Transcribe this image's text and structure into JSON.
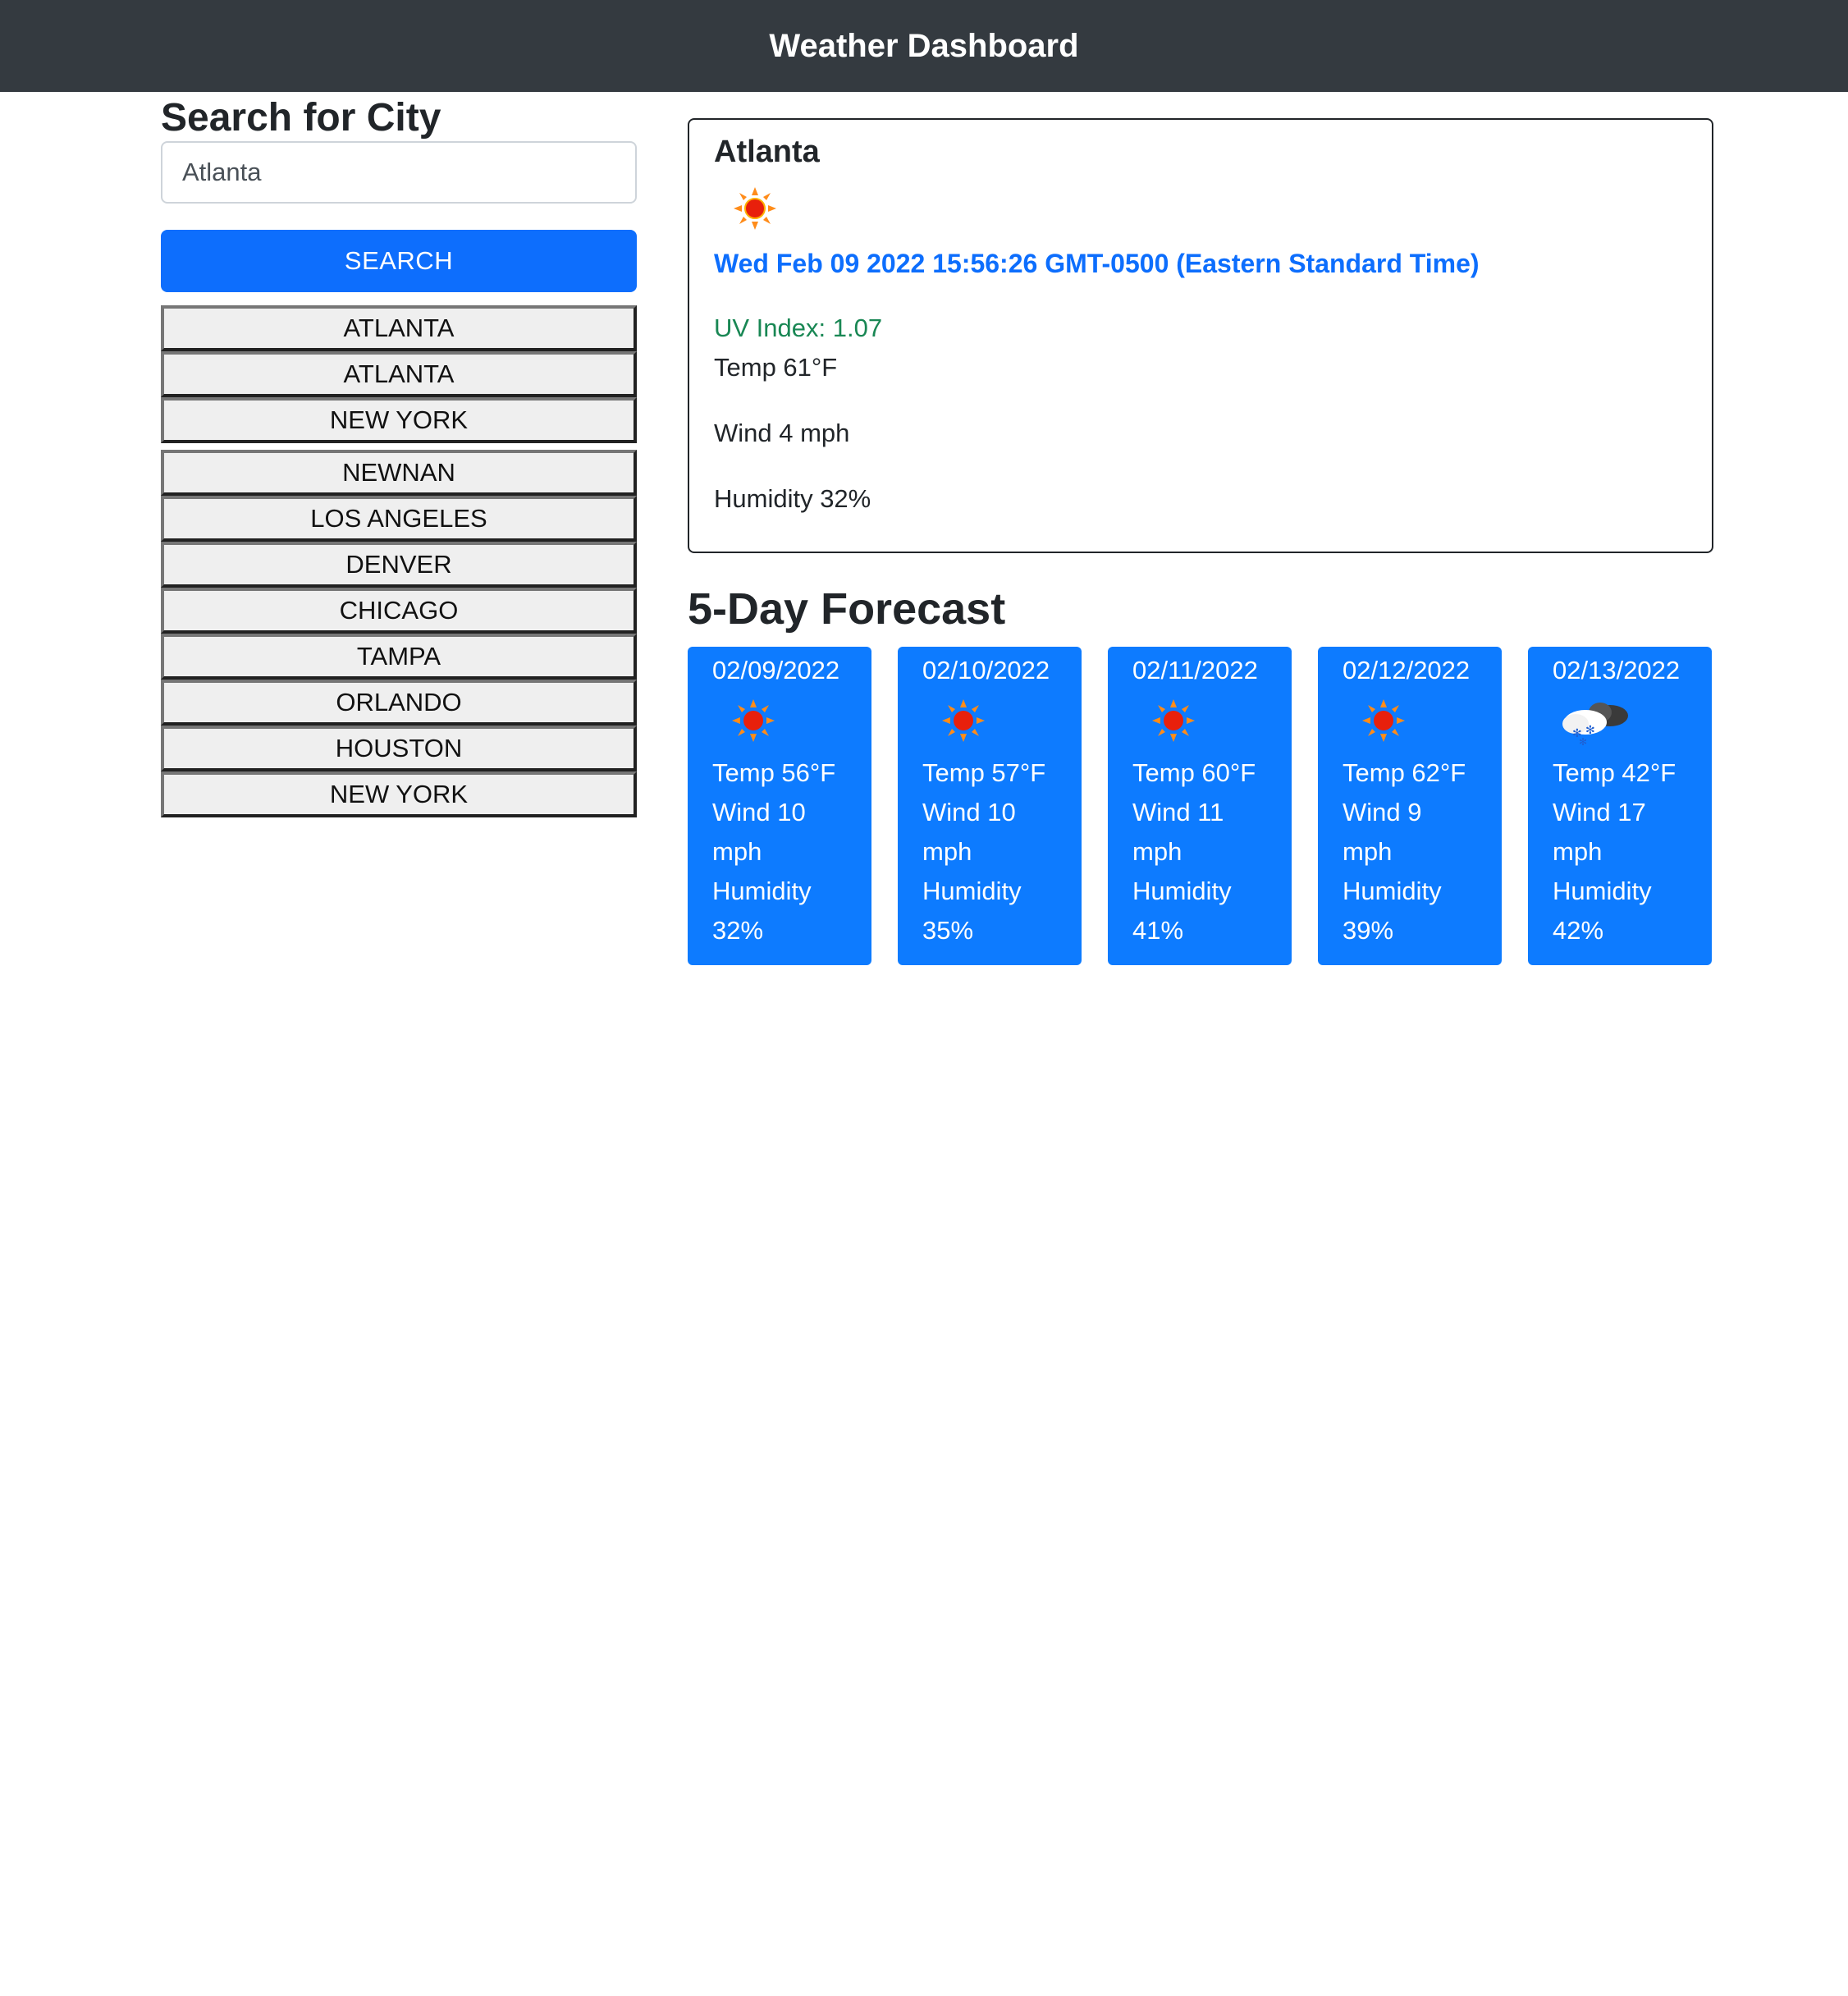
{
  "header": {
    "title": "Weather Dashboard"
  },
  "search": {
    "heading": "Search for City",
    "input_value": "Atlanta",
    "button_label": "SEARCH"
  },
  "history": [
    "ATLANTA",
    "ATLANTA",
    "NEW YORK",
    "NEWNAN",
    "LOS ANGELES",
    "DENVER",
    "CHICAGO",
    "TAMPA",
    "ORLANDO",
    "HOUSTON",
    "NEW YORK"
  ],
  "current": {
    "city": "Atlanta",
    "icon": "sun-icon",
    "date": "Wed Feb 09 2022 15:56:26 GMT-0500 (Eastern Standard Time)",
    "uv": "UV Index: 1.07",
    "temp": "Temp 61°F",
    "wind": "Wind 4 mph",
    "humidity": "Humidity 32%"
  },
  "forecast": {
    "title": "5-Day Forecast",
    "days": [
      {
        "date": "02/09/2022",
        "icon": "sun-icon",
        "temp": "Temp 56°F",
        "wind": "Wind 10",
        "wind_unit": "mph",
        "humidity_label": "Humidity",
        "humidity": "32%"
      },
      {
        "date": "02/10/2022",
        "icon": "sun-icon",
        "temp": "Temp 57°F",
        "wind": "Wind 10",
        "wind_unit": "mph",
        "humidity_label": "Humidity",
        "humidity": "35%"
      },
      {
        "date": "02/11/2022",
        "icon": "sun-icon",
        "temp": "Temp 60°F",
        "wind": "Wind 11",
        "wind_unit": "mph",
        "humidity_label": "Humidity",
        "humidity": "41%"
      },
      {
        "date": "02/12/2022",
        "icon": "sun-icon",
        "temp": "Temp 62°F",
        "wind": "Wind 9",
        "wind_unit": "mph",
        "humidity_label": "Humidity",
        "humidity": "39%"
      },
      {
        "date": "02/13/2022",
        "icon": "snow-cloud-icon",
        "temp": "Temp 42°F",
        "wind": "Wind 17",
        "wind_unit": "mph",
        "humidity_label": "Humidity",
        "humidity": "42%"
      }
    ]
  },
  "colors": {
    "navbar": "#343a40",
    "primary": "#0d6efd",
    "card": "#0d7bff",
    "uv_good": "#198754"
  }
}
